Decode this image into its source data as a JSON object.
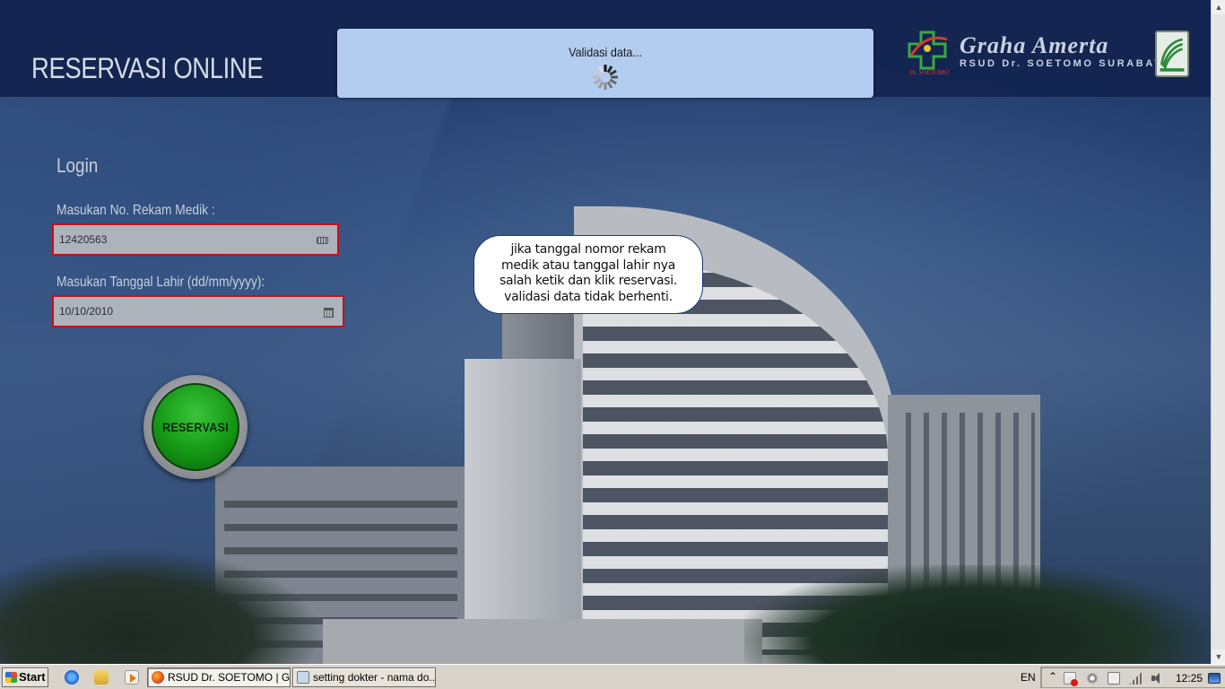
{
  "header": {
    "site_title": "RESERVASI ONLINE"
  },
  "logo": {
    "name": "Graha Amerta",
    "subtitle": "RSUD Dr. SOETOMO SURABAYA",
    "cross_caption": "Dr. SOETOMO"
  },
  "dialog": {
    "message": "Validasi data..."
  },
  "login": {
    "title": "Login",
    "rm_label": "Masukan No. Rekam Medik :",
    "rm_value": "12420563",
    "dob_label": "Masukan Tanggal Lahir (dd/mm/yyyy):",
    "dob_value": "10/10/2010",
    "submit_label": "RESERVASI"
  },
  "callout": {
    "lines": [
      "jika tanggal nomor rekam",
      "medik atau tanggal lahir nya",
      "salah ketik dan klik reservasi.",
      "validasi data tidak berhenti."
    ]
  },
  "taskbar": {
    "start_label": "Start",
    "tasks": [
      "RSUD Dr. SOETOMO | Gr...",
      "setting dokter - nama do..."
    ],
    "language": "EN",
    "clock": "12:25"
  },
  "colors": {
    "header_bg": "#12244e",
    "dialog_bg": "#b2cdf0",
    "error_border": "#c8101c",
    "button_green": "#159915"
  },
  "icons": {
    "rm_field": "keyboard-icon",
    "dob_field": "calendar-icon",
    "dialog": "spinner-icon"
  }
}
